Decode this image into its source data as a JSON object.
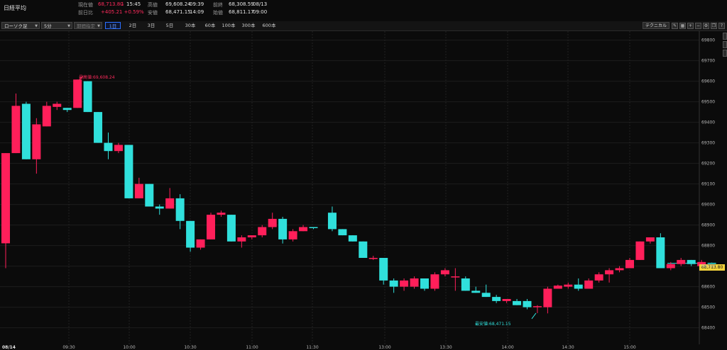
{
  "header": {
    "title": "日経平均",
    "current_label": "現在値",
    "current_value": "68,713.80",
    "current_arrow": "↓",
    "current_time": "15:45",
    "change_label": "前日比",
    "change_value": "+405.21 +0.59%",
    "high_label": "高値",
    "high_value": "69,608.24",
    "high_time": "09:39",
    "low_label": "安値",
    "low_value": "68,471.15",
    "low_time": "14:09",
    "prev_close_label": "前終",
    "prev_close_value": "68,308.59",
    "prev_close_date": "08/13",
    "open_label": "始値",
    "open_value": "68,811.17",
    "open_time": "09:00"
  },
  "toolbar": {
    "chart_type": "ローソク足",
    "interval": "5分",
    "period_placeholder": "期間指定",
    "ranges": [
      "1日",
      "2日",
      "3日",
      "5日",
      "30本",
      "60本",
      "100本",
      "300本",
      "600本"
    ],
    "active_range": "1日",
    "technical_label": "テクニカル"
  },
  "chart_data": {
    "type": "candlestick",
    "x_date_label": "08/14",
    "x_ticks": [
      "09:30",
      "10:00",
      "10:30",
      "11:00",
      "11:30",
      "13:00",
      "13:30",
      "14:00",
      "14:30",
      "15:00"
    ],
    "y_ticks": [
      68400,
      68500,
      68600,
      68700,
      68800,
      68900,
      69000,
      69100,
      69200,
      69300,
      69400,
      69500,
      69600,
      69700,
      69800
    ],
    "ylim": [
      68340,
      69840
    ],
    "last_price_label": "68,713.80",
    "high_annotation": "最高値:69,608.24",
    "low_annotation": "最安値:68,471.15",
    "up_color": "#ff1f5a",
    "down_color": "#30e0dc",
    "candles": [
      {
        "o": 68811,
        "h": 68800,
        "l": 68690,
        "c": 69250
      },
      {
        "o": 69250,
        "h": 69540,
        "l": 69250,
        "c": 69480
      },
      {
        "o": 69490,
        "h": 69500,
        "l": 69220,
        "c": 69220
      },
      {
        "o": 69220,
        "h": 69420,
        "l": 69150,
        "c": 69390
      },
      {
        "o": 69380,
        "h": 69500,
        "l": 69380,
        "c": 69480
      },
      {
        "o": 69475,
        "h": 69500,
        "l": 69460,
        "c": 69490
      },
      {
        "o": 69470,
        "h": 69460,
        "l": 69450,
        "c": 69460
      },
      {
        "o": 69470,
        "h": 69608.24,
        "l": 69470,
        "c": 69608
      },
      {
        "o": 69600,
        "h": 69600,
        "l": 69450,
        "c": 69450
      },
      {
        "o": 69450,
        "h": 69450,
        "l": 69300,
        "c": 69300
      },
      {
        "o": 69300,
        "h": 69350,
        "l": 69220,
        "c": 69260
      },
      {
        "o": 69260,
        "h": 69300,
        "l": 69250,
        "c": 69290
      },
      {
        "o": 69290,
        "h": 69290,
        "l": 69030,
        "c": 69030
      },
      {
        "o": 69030,
        "h": 69130,
        "l": 69030,
        "c": 69100
      },
      {
        "o": 69100,
        "h": 69100,
        "l": 68990,
        "c": 68990
      },
      {
        "o": 68990,
        "h": 69000,
        "l": 68950,
        "c": 68980
      },
      {
        "o": 68980,
        "h": 69080,
        "l": 68980,
        "c": 69030
      },
      {
        "o": 69030,
        "h": 69050,
        "l": 68880,
        "c": 68920
      },
      {
        "o": 68920,
        "h": 68920,
        "l": 68770,
        "c": 68790
      },
      {
        "o": 68790,
        "h": 68830,
        "l": 68780,
        "c": 68830
      },
      {
        "o": 68830,
        "h": 68960,
        "l": 68830,
        "c": 68950
      },
      {
        "o": 68950,
        "h": 68970,
        "l": 68940,
        "c": 68960
      },
      {
        "o": 68950,
        "h": 68950,
        "l": 68820,
        "c": 68820
      },
      {
        "o": 68820,
        "h": 68850,
        "l": 68790,
        "c": 68840
      },
      {
        "o": 68840,
        "h": 68850,
        "l": 68830,
        "c": 68850
      },
      {
        "o": 68850,
        "h": 68900,
        "l": 68840,
        "c": 68890
      },
      {
        "o": 68890,
        "h": 68960,
        "l": 68880,
        "c": 68930
      },
      {
        "o": 68930,
        "h": 68940,
        "l": 68810,
        "c": 68830
      },
      {
        "o": 68830,
        "h": 68880,
        "l": 68820,
        "c": 68870
      },
      {
        "o": 68870,
        "h": 68900,
        "l": 68870,
        "c": 68890
      },
      {
        "o": 68890,
        "h": 68890,
        "l": 68880,
        "c": 68885
      },
      {
        "o": 68960,
        "h": 68990,
        "l": 68870,
        "c": 68880
      },
      {
        "o": 68880,
        "h": 68880,
        "l": 68850,
        "c": 68850
      },
      {
        "o": 68850,
        "h": 68850,
        "l": 68820,
        "c": 68820
      },
      {
        "o": 68820,
        "h": 68820,
        "l": 68740,
        "c": 68740
      },
      {
        "o": 68740,
        "h": 68750,
        "l": 68730,
        "c": 68740
      },
      {
        "o": 68740,
        "h": 68740,
        "l": 68610,
        "c": 68630
      },
      {
        "o": 68630,
        "h": 68640,
        "l": 68570,
        "c": 68600
      },
      {
        "o": 68600,
        "h": 68640,
        "l": 68580,
        "c": 68630
      },
      {
        "o": 68600,
        "h": 68650,
        "l": 68590,
        "c": 68640
      },
      {
        "o": 68640,
        "h": 68640,
        "l": 68580,
        "c": 68590
      },
      {
        "o": 68590,
        "h": 68670,
        "l": 68580,
        "c": 68660
      },
      {
        "o": 68660,
        "h": 68690,
        "l": 68650,
        "c": 68680
      },
      {
        "o": 68650,
        "h": 68690,
        "l": 68580,
        "c": 68650
      },
      {
        "o": 68640,
        "h": 68650,
        "l": 68580,
        "c": 68580
      },
      {
        "o": 68580,
        "h": 68600,
        "l": 68570,
        "c": 68570
      },
      {
        "o": 68570,
        "h": 68610,
        "l": 68550,
        "c": 68550
      },
      {
        "o": 68550,
        "h": 68560,
        "l": 68520,
        "c": 68530
      },
      {
        "o": 68530,
        "h": 68540,
        "l": 68520,
        "c": 68540
      },
      {
        "o": 68530,
        "h": 68540,
        "l": 68510,
        "c": 68510
      },
      {
        "o": 68530,
        "h": 68540,
        "l": 68490,
        "c": 68500
      },
      {
        "o": 68500,
        "h": 68510,
        "l": 68471.15,
        "c": 68505
      },
      {
        "o": 68500,
        "h": 68600,
        "l": 68470,
        "c": 68590
      },
      {
        "o": 68590,
        "h": 68610,
        "l": 68590,
        "c": 68605
      },
      {
        "o": 68600,
        "h": 68620,
        "l": 68590,
        "c": 68610
      },
      {
        "o": 68610,
        "h": 68640,
        "l": 68580,
        "c": 68590
      },
      {
        "o": 68590,
        "h": 68640,
        "l": 68590,
        "c": 68630
      },
      {
        "o": 68630,
        "h": 68670,
        "l": 68620,
        "c": 68660
      },
      {
        "o": 68660,
        "h": 68690,
        "l": 68620,
        "c": 68680
      },
      {
        "o": 68680,
        "h": 68700,
        "l": 68670,
        "c": 68690
      },
      {
        "o": 68690,
        "h": 68740,
        "l": 68690,
        "c": 68730
      },
      {
        "o": 68730,
        "h": 68820,
        "l": 68730,
        "c": 68820
      },
      {
        "o": 68820,
        "h": 68840,
        "l": 68810,
        "c": 68840
      },
      {
        "o": 68840,
        "h": 68860,
        "l": 68690,
        "c": 68690
      },
      {
        "o": 68690,
        "h": 68720,
        "l": 68680,
        "c": 68710
      },
      {
        "o": 68710,
        "h": 68740,
        "l": 68700,
        "c": 68730
      },
      {
        "o": 68730,
        "h": 68730,
        "l": 68700,
        "c": 68710
      },
      {
        "o": 68700,
        "h": 68730,
        "l": 68700,
        "c": 68720
      },
      {
        "o": 68716,
        "h": 68717,
        "l": 68712,
        "c": 68714
      }
    ]
  }
}
